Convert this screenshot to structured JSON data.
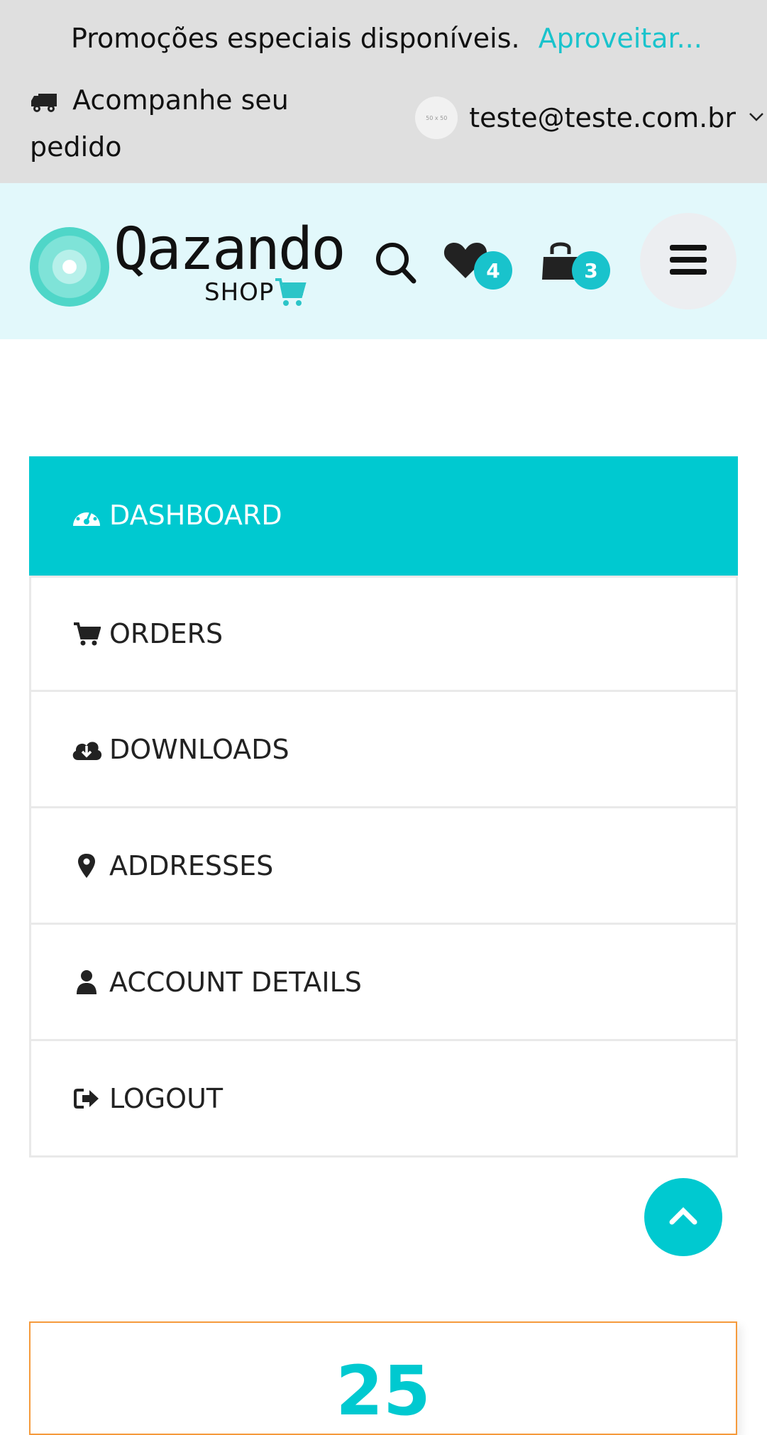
{
  "topbar": {
    "promo_text": "Promoções especiais disponíveis.",
    "promo_link": "Aproveitar...",
    "track_label": "Acompanhe seu pedido",
    "avatar_text": "50 x 50",
    "user_email": "teste@teste.com.br"
  },
  "header": {
    "logo_name": "Qazando",
    "logo_sub": "SHOP",
    "wishlist_count": "4",
    "cart_count": "3"
  },
  "nav": {
    "items": [
      {
        "label": "DASHBOARD",
        "icon": "dashboard-icon",
        "active": true
      },
      {
        "label": "ORDERS",
        "icon": "cart-icon"
      },
      {
        "label": "DOWNLOADS",
        "icon": "cloud-download-icon"
      },
      {
        "label": "ADDRESSES",
        "icon": "map-marker-icon"
      },
      {
        "label": "ACCOUNT DETAILS",
        "icon": "user-icon"
      },
      {
        "label": "LOGOUT",
        "icon": "sign-out-icon"
      }
    ]
  },
  "stats": {
    "value": "25"
  },
  "colors": {
    "accent": "#00c9d0",
    "card_border": "#f59a3c",
    "topbar_bg": "#dfdfdf",
    "header_bg": "#e2f8fb"
  }
}
